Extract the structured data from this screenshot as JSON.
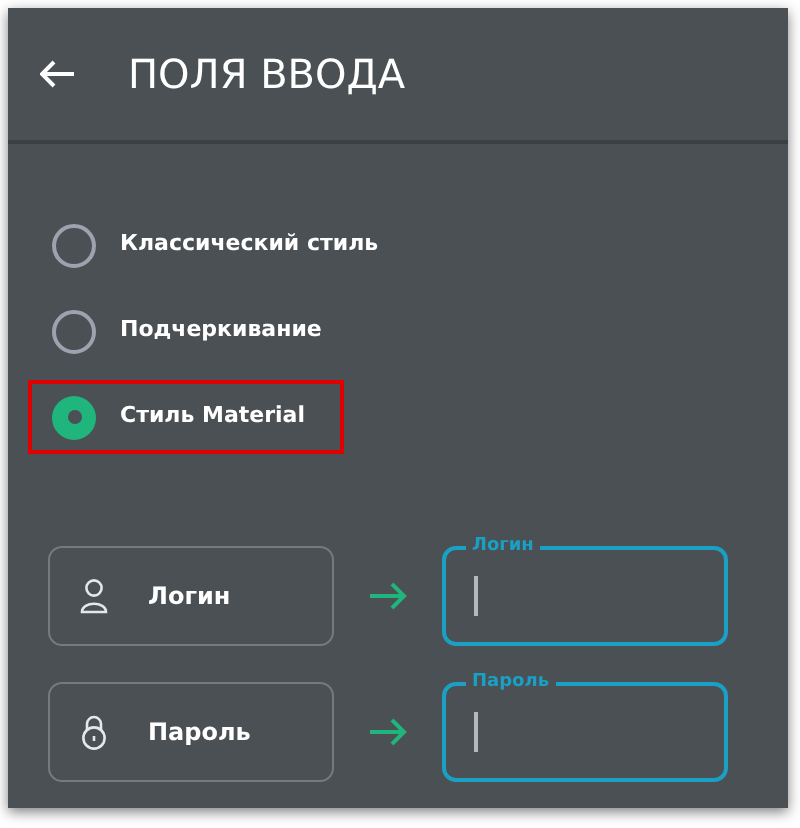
{
  "header": {
    "title": "ПОЛЯ ВВОДА"
  },
  "options": [
    {
      "label": "Классический стиль",
      "selected": false,
      "highlighted": false
    },
    {
      "label": "Подчеркивание",
      "selected": false,
      "highlighted": false
    },
    {
      "label": "Стиль Material",
      "selected": true,
      "highlighted": true
    }
  ],
  "examples": [
    {
      "before": "Логин",
      "after_label": "Логин"
    },
    {
      "before": "Пароль",
      "after_label": "Пароль"
    }
  ]
}
